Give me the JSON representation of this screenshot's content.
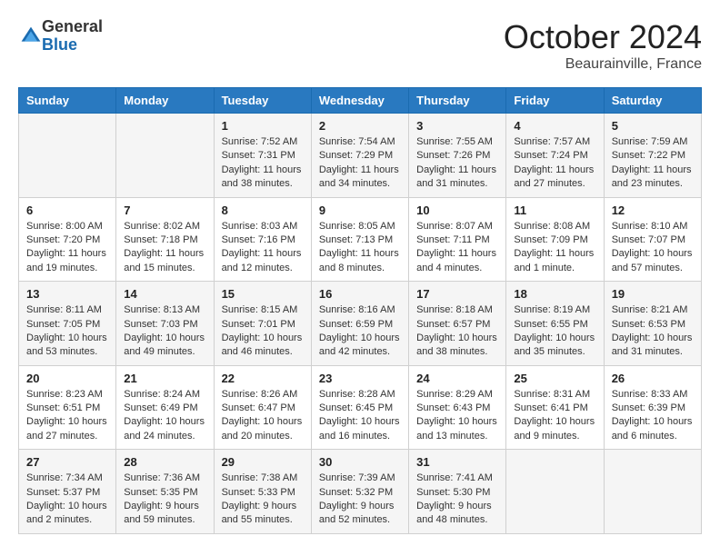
{
  "logo": {
    "general": "General",
    "blue": "Blue"
  },
  "title": "October 2024",
  "location": "Beaurainville, France",
  "headers": [
    "Sunday",
    "Monday",
    "Tuesday",
    "Wednesday",
    "Thursday",
    "Friday",
    "Saturday"
  ],
  "rows": [
    [
      {
        "day": "",
        "text": ""
      },
      {
        "day": "",
        "text": ""
      },
      {
        "day": "1",
        "text": "Sunrise: 7:52 AM\nSunset: 7:31 PM\nDaylight: 11 hours and 38 minutes."
      },
      {
        "day": "2",
        "text": "Sunrise: 7:54 AM\nSunset: 7:29 PM\nDaylight: 11 hours and 34 minutes."
      },
      {
        "day": "3",
        "text": "Sunrise: 7:55 AM\nSunset: 7:26 PM\nDaylight: 11 hours and 31 minutes."
      },
      {
        "day": "4",
        "text": "Sunrise: 7:57 AM\nSunset: 7:24 PM\nDaylight: 11 hours and 27 minutes."
      },
      {
        "day": "5",
        "text": "Sunrise: 7:59 AM\nSunset: 7:22 PM\nDaylight: 11 hours and 23 minutes."
      }
    ],
    [
      {
        "day": "6",
        "text": "Sunrise: 8:00 AM\nSunset: 7:20 PM\nDaylight: 11 hours and 19 minutes."
      },
      {
        "day": "7",
        "text": "Sunrise: 8:02 AM\nSunset: 7:18 PM\nDaylight: 11 hours and 15 minutes."
      },
      {
        "day": "8",
        "text": "Sunrise: 8:03 AM\nSunset: 7:16 PM\nDaylight: 11 hours and 12 minutes."
      },
      {
        "day": "9",
        "text": "Sunrise: 8:05 AM\nSunset: 7:13 PM\nDaylight: 11 hours and 8 minutes."
      },
      {
        "day": "10",
        "text": "Sunrise: 8:07 AM\nSunset: 7:11 PM\nDaylight: 11 hours and 4 minutes."
      },
      {
        "day": "11",
        "text": "Sunrise: 8:08 AM\nSunset: 7:09 PM\nDaylight: 11 hours and 1 minute."
      },
      {
        "day": "12",
        "text": "Sunrise: 8:10 AM\nSunset: 7:07 PM\nDaylight: 10 hours and 57 minutes."
      }
    ],
    [
      {
        "day": "13",
        "text": "Sunrise: 8:11 AM\nSunset: 7:05 PM\nDaylight: 10 hours and 53 minutes."
      },
      {
        "day": "14",
        "text": "Sunrise: 8:13 AM\nSunset: 7:03 PM\nDaylight: 10 hours and 49 minutes."
      },
      {
        "day": "15",
        "text": "Sunrise: 8:15 AM\nSunset: 7:01 PM\nDaylight: 10 hours and 46 minutes."
      },
      {
        "day": "16",
        "text": "Sunrise: 8:16 AM\nSunset: 6:59 PM\nDaylight: 10 hours and 42 minutes."
      },
      {
        "day": "17",
        "text": "Sunrise: 8:18 AM\nSunset: 6:57 PM\nDaylight: 10 hours and 38 minutes."
      },
      {
        "day": "18",
        "text": "Sunrise: 8:19 AM\nSunset: 6:55 PM\nDaylight: 10 hours and 35 minutes."
      },
      {
        "day": "19",
        "text": "Sunrise: 8:21 AM\nSunset: 6:53 PM\nDaylight: 10 hours and 31 minutes."
      }
    ],
    [
      {
        "day": "20",
        "text": "Sunrise: 8:23 AM\nSunset: 6:51 PM\nDaylight: 10 hours and 27 minutes."
      },
      {
        "day": "21",
        "text": "Sunrise: 8:24 AM\nSunset: 6:49 PM\nDaylight: 10 hours and 24 minutes."
      },
      {
        "day": "22",
        "text": "Sunrise: 8:26 AM\nSunset: 6:47 PM\nDaylight: 10 hours and 20 minutes."
      },
      {
        "day": "23",
        "text": "Sunrise: 8:28 AM\nSunset: 6:45 PM\nDaylight: 10 hours and 16 minutes."
      },
      {
        "day": "24",
        "text": "Sunrise: 8:29 AM\nSunset: 6:43 PM\nDaylight: 10 hours and 13 minutes."
      },
      {
        "day": "25",
        "text": "Sunrise: 8:31 AM\nSunset: 6:41 PM\nDaylight: 10 hours and 9 minutes."
      },
      {
        "day": "26",
        "text": "Sunrise: 8:33 AM\nSunset: 6:39 PM\nDaylight: 10 hours and 6 minutes."
      }
    ],
    [
      {
        "day": "27",
        "text": "Sunrise: 7:34 AM\nSunset: 5:37 PM\nDaylight: 10 hours and 2 minutes."
      },
      {
        "day": "28",
        "text": "Sunrise: 7:36 AM\nSunset: 5:35 PM\nDaylight: 9 hours and 59 minutes."
      },
      {
        "day": "29",
        "text": "Sunrise: 7:38 AM\nSunset: 5:33 PM\nDaylight: 9 hours and 55 minutes."
      },
      {
        "day": "30",
        "text": "Sunrise: 7:39 AM\nSunset: 5:32 PM\nDaylight: 9 hours and 52 minutes."
      },
      {
        "day": "31",
        "text": "Sunrise: 7:41 AM\nSunset: 5:30 PM\nDaylight: 9 hours and 48 minutes."
      },
      {
        "day": "",
        "text": ""
      },
      {
        "day": "",
        "text": ""
      }
    ]
  ]
}
